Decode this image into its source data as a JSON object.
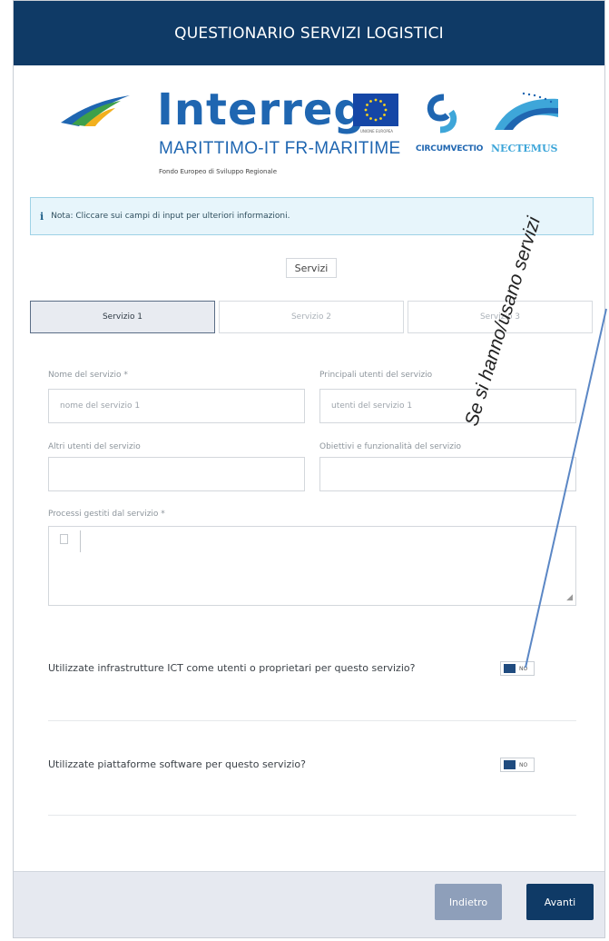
{
  "header": {
    "title": "QUESTIONARIO SERVIZI LOGISTICI"
  },
  "logos": {
    "interreg": "Interreg",
    "maritime": "MARITTIMO-IT FR-MARITIME",
    "fund": "Fondo Europeo di Sviluppo Regionale",
    "eu_caption": "UNIONE EUROPEA",
    "circumvectio": "CIRCUMVECTIO",
    "nectemus": "NECTEMUS"
  },
  "note": {
    "icon": "info-icon",
    "text": "Nota: Cliccare sui campi di input per ulteriori informazioni."
  },
  "section": {
    "label": "Servizi"
  },
  "tabs": [
    {
      "label": "Servizio 1",
      "active": true
    },
    {
      "label": "Servizio 2",
      "active": false
    },
    {
      "label": "Servizio 3",
      "active": false
    }
  ],
  "form": {
    "name_label": "Nome del servizio *",
    "name_placeholder": "nome del servizio 1",
    "users_label": "Principali utenti del servizio",
    "users_placeholder": "utenti del servizio 1",
    "other_users_label": "Altri utenti del servizio",
    "other_users_value": "",
    "objectives_label": "Obiettivi e funzionalità del servizio",
    "objectives_value": "",
    "processes_label": "Processi gestiti dal servizio *",
    "processes_value": ""
  },
  "questions": [
    {
      "text": "Utilizzate infrastrutture ICT come utenti o proprietari per questo servizio?",
      "toggle": "NO"
    },
    {
      "text": "Utilizzate piattaforme software per questo servizio?",
      "toggle": "NO"
    }
  ],
  "footer": {
    "back": "Indietro",
    "next": "Avanti"
  },
  "annotation": {
    "text": "Se si hanno/usano servizi"
  },
  "colors": {
    "header": "#0f3a66",
    "accent": "#1f4b7f",
    "note_bg": "#e7f5fb",
    "annotation_line": "#5b87c5"
  }
}
